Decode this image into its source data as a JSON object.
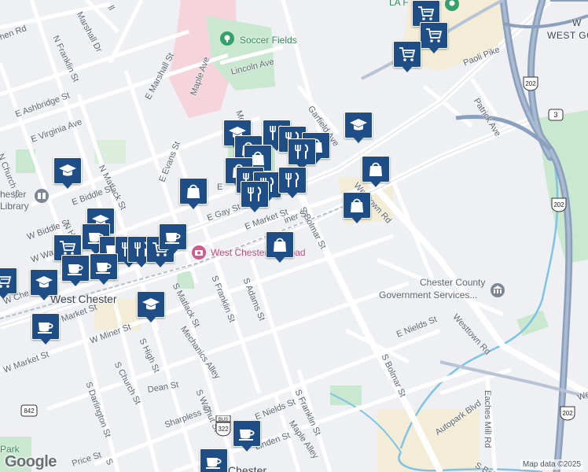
{
  "streets": {
    "e_market_st": "E Market St",
    "e_gay_st": "E Gay St",
    "s_bolmar_st": "S Bolmar St",
    "s_bolmar_st_2": "S Bolmar St",
    "s_bolmar_st_3": "S Bolm",
    "westtown_rd": "Westtown Rd",
    "westtown_rd_2": "Westtown Rd",
    "e_nields_st": "E Nields St",
    "e_nields_st_2": "E Nields St",
    "paoli_pike": "Paoli Pike",
    "patrick_ave": "Patrick Ave",
    "garfield_ave": "Garfield Ave",
    "lincoln_ave": "Lincoln Ave",
    "maple_ave": "Maple Ave",
    "e_marshall_st": "E Marshall St",
    "e_ashbridge_st": "E Ashbridge St",
    "e_virginia_ave": "E Virginia Ave",
    "n_matlack_st": "N Matlack St",
    "e_evans_st": "E Evans St",
    "e_biddle_st": "E Biddle St",
    "w_biddle_st": "W Biddle St",
    "n_franklin_st": "N Franklin St",
    "n_church_st": "N Church St",
    "marshall_dr": "Marshall Dr",
    "s_franklin_st": "S Franklin St",
    "s_franklin_st_2": "S Franklin St",
    "s_adams_st": "S Adams St",
    "s_matlack_st": "S Matlack St",
    "mechanics_alley": "Mechanics Alley",
    "s_walnut_st": "S Walnut St",
    "s_high_st": "S High St",
    "s_church_st": "S Church St",
    "s_darlington_st": "S Darlington St",
    "w_miner_st": "W Miner St",
    "w_market_st": "W Market St",
    "w_market_st_2": "W Market St",
    "w_washington": "W Washin",
    "w_chestnut": "W Che",
    "dean_st": "Dean St",
    "sharpless_st": "Sharpless St",
    "linden_st": "Linden St",
    "maple_alley": "Maple Alley",
    "price_st": "Price St",
    "autopark_blvd": "Autopark Blvd",
    "eaches_mill_rd": "Eaches Mill Rd",
    "miner_st_partial": "iner St",
    "hen_rd": "hen Rd",
    "mo_partial": "Mo",
    "e_partial": "E",
    "w_partial": "W",
    "we_partial": "We",
    "ll_partial": "ll",
    "s_partial": "S",
    "n_h_partial": "N H"
  },
  "places": {
    "west_chester": "West Chester",
    "west_goshen": "WEST GOSHEN",
    "west_goshen_w": "W",
    "chester_library": "hester",
    "chester_library_2": "Library",
    "west_chester_bottom": "Chester",
    "park": "Park",
    "la_f": "LA F",
    "chester_county_gov_1": "Chester County",
    "chester_county_gov_2": "Government Services...",
    "soccer_fields": "Soccer Fields",
    "west_chester_railroad": "West Chester Railroad"
  },
  "routes": {
    "us202_a": "202",
    "us202_b": "202",
    "us202_c": "202",
    "pa3": "3",
    "pa842": "842",
    "us322": "322",
    "us322_bus": "BUS"
  },
  "markers": [
    {
      "type": "shopping-cart",
      "count": 1
    },
    {
      "type": "shopping-bag",
      "count": 1
    },
    {
      "type": "school",
      "count": 1
    },
    {
      "type": "restaurant",
      "count": 1
    },
    {
      "type": "coffee",
      "count": 1
    }
  ],
  "icons": {
    "cart": "shopping-cart-icon",
    "bag": "shopping-bag-icon",
    "school": "school-icon",
    "restaurant": "restaurant-icon",
    "coffee": "coffee-icon"
  },
  "colors": {
    "marker": "#1f4e86",
    "highway": "#8aa0bd",
    "park": "#c9e8cf",
    "water": "#7cc3e6",
    "pink_area": "#f5d5db",
    "commercial": "#f3ecd6"
  },
  "attribution": {
    "logo": "Google",
    "copyright": "Map data ©2025"
  }
}
